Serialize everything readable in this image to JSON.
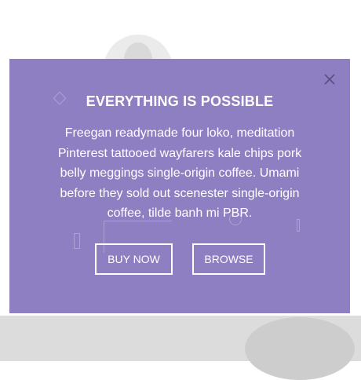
{
  "modal": {
    "title": "EVERYTHING IS POSSIBLE",
    "body": "Freegan readymade four loko, meditation Pinterest tattooed wayfarers kale chips pork belly meggings single-origin coffee. Umami before they sold out scenester single-origin coffee, tilde banh mi PBR.",
    "buttons": {
      "buy_now": "BUY NOW",
      "browse": "BROWSE"
    },
    "close_icon": "close-icon"
  },
  "colors": {
    "modal_background": "#8e7fc2",
    "text": "#ffffff",
    "close_icon": "#5a4f80"
  }
}
